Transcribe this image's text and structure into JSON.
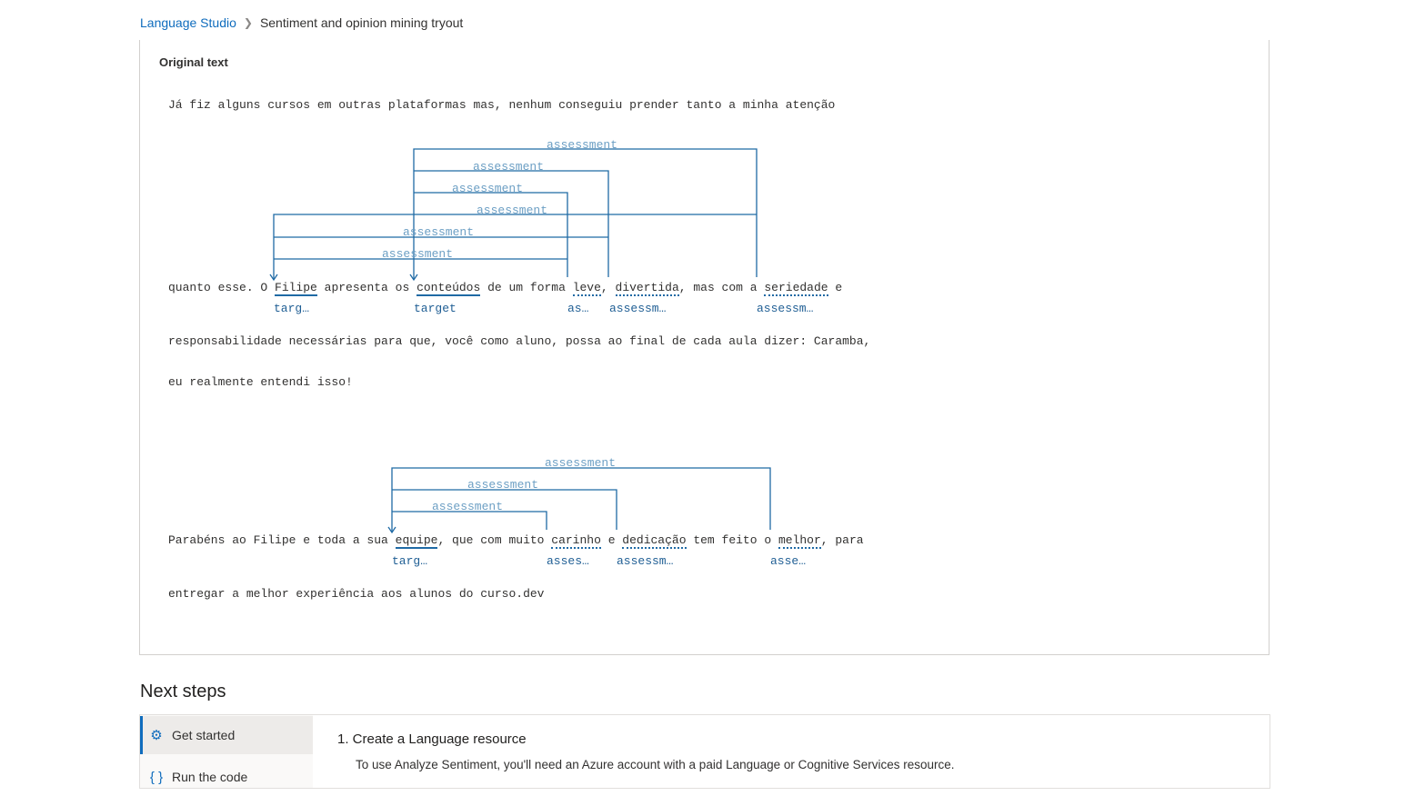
{
  "breadcrumb": {
    "root": "Language Studio",
    "current": "Sentiment and opinion mining tryout"
  },
  "original_text": {
    "title": "Original text",
    "line1": "Já fiz alguns cursos em outras plataformas mas, nenhum conseguiu prender tanto a minha atenção",
    "line2": {
      "pre1": "quanto esse. O ",
      "t_filipe": "Filipe",
      "mid1": " apresenta os ",
      "t_conteudos": "conteúdos",
      "mid2": " de um forma ",
      "a_leve": "leve",
      "mid3": ", ",
      "a_divertida": "divertida",
      "mid4": ", mas com a ",
      "a_seriedade": "seriedade",
      "post": " e"
    },
    "line2_labels": {
      "filipe": "targ…",
      "conteudos": "target",
      "leve": "as…",
      "divertida": "assessm…",
      "seriedade": "assessm…"
    },
    "line3": "responsabilidade necessárias para que, você como aluno, possa ao final de cada aula dizer: Caramba,",
    "line4": "eu realmente entendi isso!",
    "line5": {
      "pre1": "Parabéns ao Filipe e toda a sua ",
      "t_equipe": "equipe",
      "mid1": ", que com muito ",
      "a_carinho": "carinho",
      "mid2": " e ",
      "a_dedicacao": "dedicação",
      "mid3": " tem feito o ",
      "a_melhor": "melhor",
      "post": ", para"
    },
    "line5_labels": {
      "equipe": "targ…",
      "carinho": "asses…",
      "dedicacao": "assessm…",
      "melhor": "asse…"
    },
    "line6": "entregar a melhor experiência aos alunos do curso.dev",
    "arc_label": "assessment"
  },
  "next_steps": {
    "title": "Next steps",
    "nav": [
      {
        "label": "Get started",
        "icon": "gear-icon"
      },
      {
        "label": "Run the code",
        "icon": "code-braces-icon"
      }
    ],
    "step_title": "1. Create a Language resource",
    "step_desc": "To use Analyze Sentiment, you'll need an Azure account with a paid Language or Cognitive Services resource."
  },
  "colors": {
    "accent": "#0f6cbd",
    "relation_line": "#1f6aa5",
    "relation_label": "#6c9fc4"
  }
}
